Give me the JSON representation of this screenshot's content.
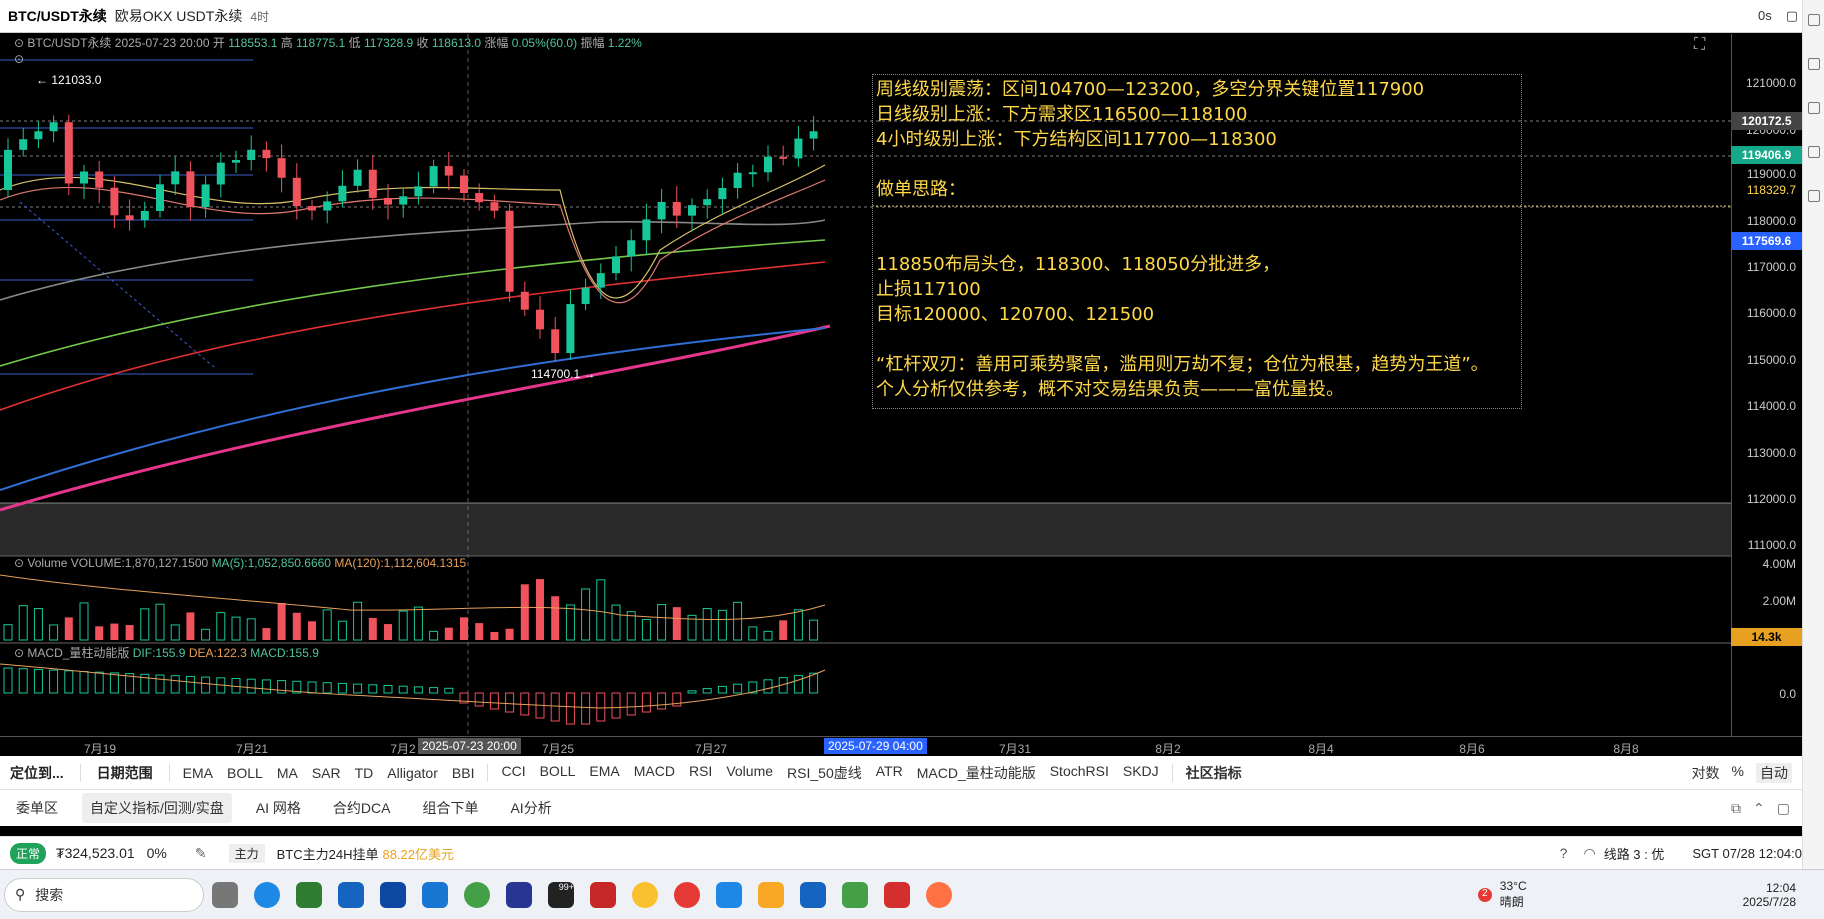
{
  "header": {
    "symbol": "BTC/USDT永续",
    "exchange": "欧易OKX USDT永续",
    "timeframe": "4时",
    "right_label": "0s"
  },
  "ohlc_line": {
    "symbol": "BTC/USDT永续",
    "date": "2025-07-23 20:00",
    "open_label": "开",
    "open": "118553.1",
    "high_label": "高",
    "high": "118775.1",
    "low_label": "低",
    "low": "117328.9",
    "close_label": "收",
    "close": "118613.0",
    "change_label": "涨幅",
    "change": "0.05%(60.0)",
    "amp_label": "振幅",
    "amp": "1.22%"
  },
  "price_scale": [
    "121000.0",
    "120000.0",
    "119000.0",
    "118000.0",
    "117000.0",
    "116000.0",
    "115000.0",
    "114000.0",
    "113000.0",
    "112000.0",
    "111000.0"
  ],
  "price_tags": {
    "crosshair": "120172.5",
    "last": "119406.9",
    "line": "118329.7",
    "ma": "117569.6"
  },
  "markers": {
    "high": "← 121033.0",
    "low": "114700.1 →"
  },
  "annotation": {
    "lines": [
      "周线级别震荡：区间104700—123200，多空分界关键位置117900",
      "日线级别上涨：下方需求区116500—118100",
      "4小时级别上涨：下方结构区间117700—118300",
      "",
      "做单思路：",
      "",
      "",
      "118850布局头仓，118300、118050分批进多，",
      "止损117100",
      "目标120000、120700、121500",
      "",
      "“杠杆双刃：善用可乘势聚富，滥用则万劫不复；仓位为根基，趋势为王道”。",
      "个人分析仅供参考，概不对交易结果负责———富优量投。"
    ]
  },
  "volume": {
    "title": "Volume",
    "value": "VOLUME:1,870,127.1500",
    "ma5": "MA(5):1,052,850.6660",
    "ma120": "MA(120):1,112,604.1315",
    "scale": [
      "4.00M",
      "2.00M"
    ],
    "tag": "14.3k"
  },
  "macd": {
    "title": "MACD_量柱动能版",
    "dif": "DIF:155.9",
    "dea": "DEA:122.3",
    "macd": "MACD:155.9",
    "scale": "0.0"
  },
  "time_axis": {
    "labels": [
      "7月19",
      "7月21",
      "7月2",
      "7月25",
      "7月27",
      "7月31",
      "8月2",
      "8月4",
      "8月6",
      "8月8"
    ],
    "crosshair_time": "2025-07-23 20:00",
    "last_time": "2025-07-29 04:00"
  },
  "indicator_bar": {
    "locate": "定位到...",
    "date_range": "日期范围",
    "main": [
      "EMA",
      "BOLL",
      "MA",
      "SAR",
      "TD",
      "Alligator",
      "BBI"
    ],
    "sub": [
      "CCI",
      "BOLL",
      "EMA",
      "MACD",
      "RSI",
      "Volume",
      "RSI_50虚线",
      "ATR",
      "MACD_量柱动能版",
      "StochRSI",
      "SKDJ"
    ],
    "community": "社区指标",
    "right": [
      "对数",
      "%",
      "自动"
    ]
  },
  "bottom_tabs": [
    "委单区",
    "自定义指标/回测/实盘",
    "AI 网格",
    "合约DCA",
    "组合下单",
    "AI分析"
  ],
  "status": {
    "state": "正常",
    "balance": "₮324,523.01",
    "pct": "0%",
    "main_label": "主力",
    "main_text": "BTC主力24H挂单",
    "main_value": "88.22亿美元",
    "line": "线路 3 : 优",
    "time": "SGT 07/28 12:04:0"
  },
  "taskbar": {
    "search": "搜索",
    "weather_temp": "33°C",
    "weather_desc": "晴朗",
    "weather_badge": "2",
    "clock_time": "12:04",
    "clock_date": "2025/7/28",
    "notif": "99+"
  }
}
